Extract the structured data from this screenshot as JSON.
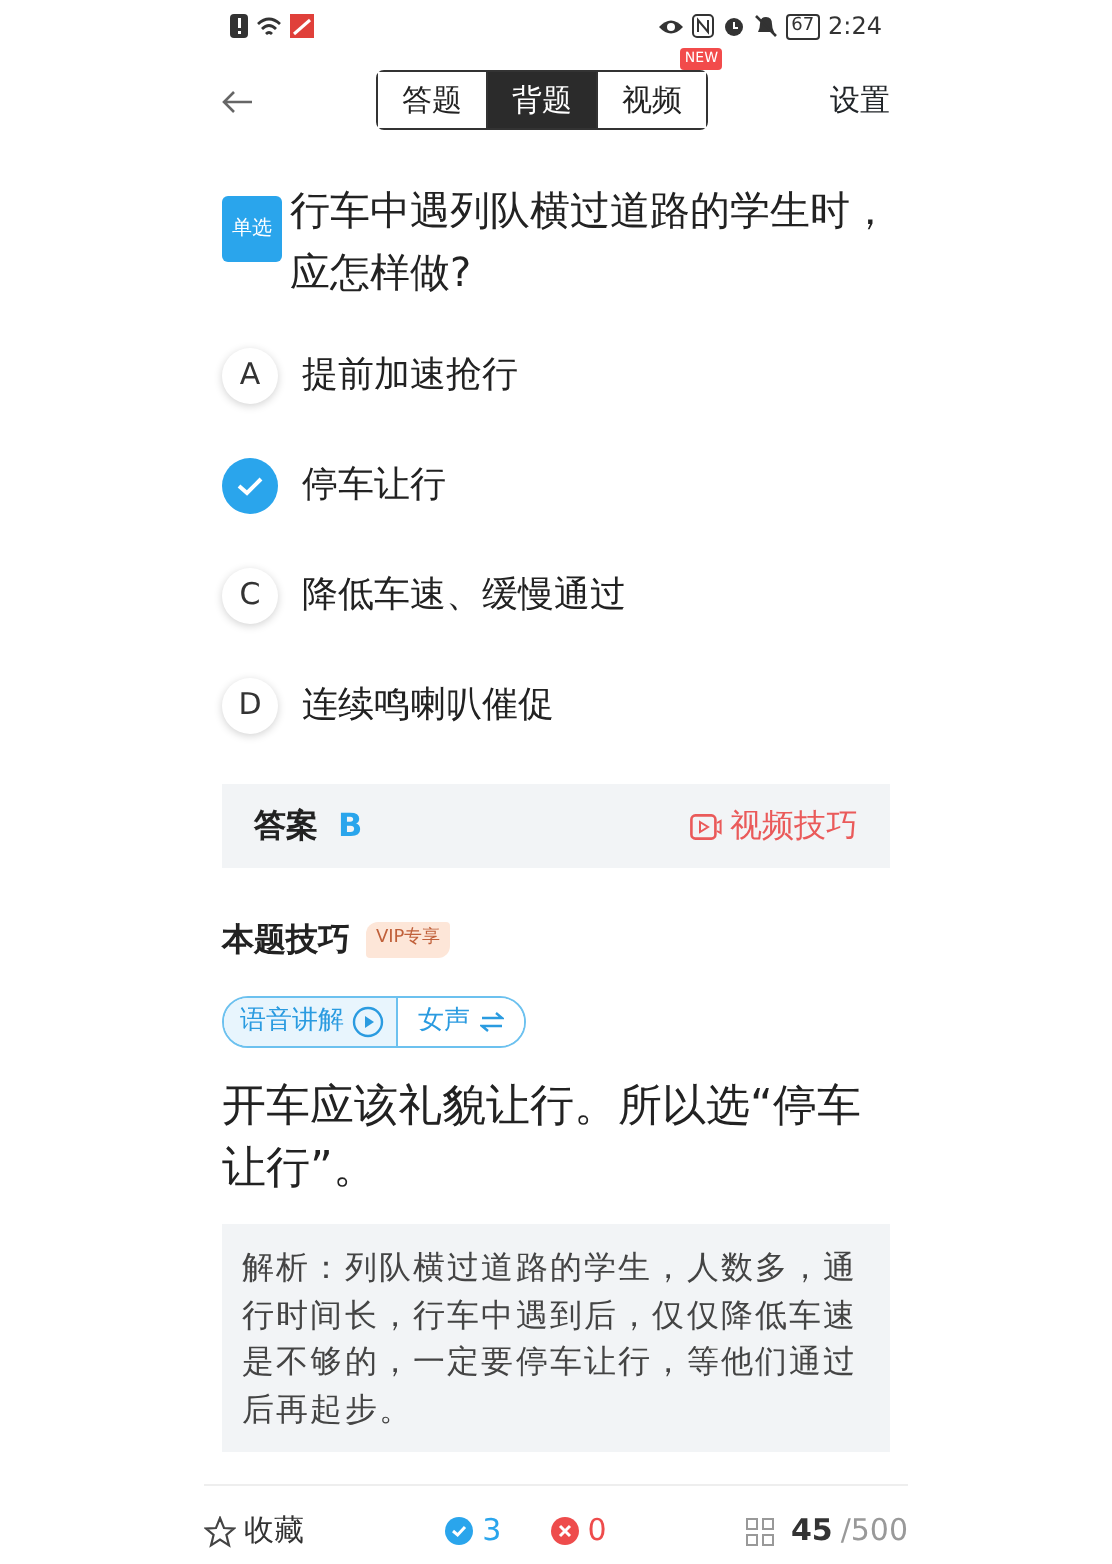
{
  "status_bar": {
    "battery": "67",
    "time": "2:24"
  },
  "header": {
    "tabs": [
      {
        "label": "答题",
        "selected": false
      },
      {
        "label": "背题",
        "selected": true
      },
      {
        "label": "视频",
        "selected": false,
        "badge": "NEW"
      }
    ],
    "settings": "设置"
  },
  "question": {
    "type_tag": "单选",
    "text": "行车中遇列队横过道路的学生时，应怎样做?"
  },
  "options": [
    {
      "letter": "A",
      "text": "提前加速抢行",
      "selected": false
    },
    {
      "text": "停车让行",
      "selected": true
    },
    {
      "letter": "C",
      "text": "降低车速、缓慢通过",
      "selected": false
    },
    {
      "letter": "D",
      "text": "连续鸣喇叭催促",
      "selected": false
    }
  ],
  "answer": {
    "label": "答案",
    "value": "B",
    "video_link": "视频技巧"
  },
  "tips": {
    "title": "本题技巧",
    "vip_tag": "VIP专享",
    "voice": "语音讲解",
    "voice_gender": "女声",
    "summary": "开车应该礼貌让行。所以选“停车让行”。",
    "analysis": "解析：列队横过道路的学生，人数多，通行时间长，行车中遇到后，仅仅降低车速是不够的，一定要停车让行，等他们通过后再起步。"
  },
  "footer": {
    "favorite": "收藏",
    "correct": "3",
    "wrong": "0",
    "current": "45",
    "total": "/500"
  }
}
